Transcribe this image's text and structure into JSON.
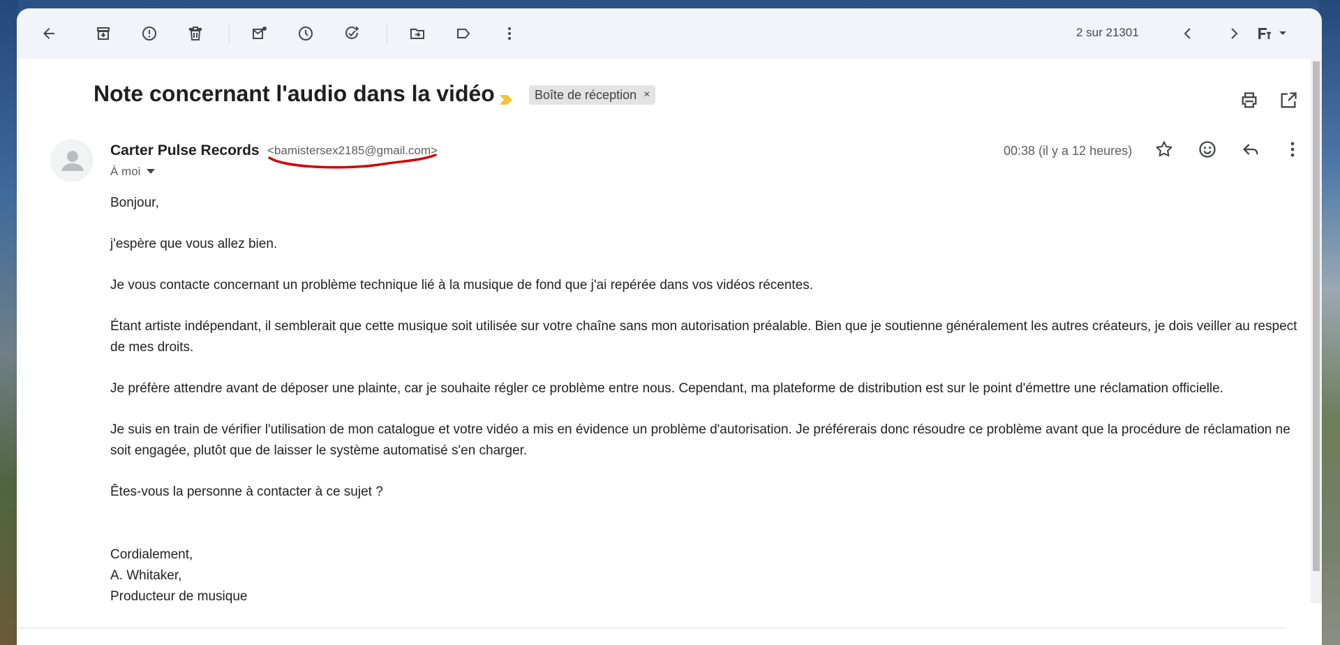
{
  "toolbar": {
    "pager_text": "2 sur 21301"
  },
  "email": {
    "subject": "Note concernant l'audio dans la vidéo",
    "label": "Boîte de réception",
    "label_close": "×",
    "sender_name": "Carter Pulse Records",
    "sender_email": "<bamistersex2185@gmail.com>",
    "to_line": "À moi",
    "timestamp": "00:38 (il y a 12 heures)",
    "body": [
      "Bonjour,",
      "j'espère que vous allez bien.",
      "Je vous contacte concernant un problème technique lié à la musique de fond que j'ai repérée dans vos vidéos récentes.",
      "Étant artiste indépendant, il semblerait que cette musique soit utilisée sur votre chaîne sans mon autorisation préalable. Bien que je soutienne généralement les autres créateurs, je dois veiller au respect de mes droits.",
      "Je préfère attendre avant de déposer une plainte, car je souhaite régler ce problème entre nous. Cependant, ma plateforme de distribution est sur le point d'émettre une réclamation officielle.",
      "Je suis en train de vérifier l'utilisation de mon catalogue et votre vidéo a mis en évidence un problème d'autorisation. Je préférerais donc résoudre ce problème avant que la procédure de réclamation ne soit engagée, plutôt que de laisser le système automatisé s'en charger.",
      "Êtes-vous la personne à contacter à ce sujet ?"
    ],
    "signature": [
      "Cordialement,",
      "A. Whitaker,",
      "Producteur de musique"
    ]
  },
  "colors": {
    "importance_marker": "#f4c430",
    "annotation_underline": "#d40000",
    "toolbar_bg": "#f1f4f9"
  },
  "icons": [
    "back-arrow-icon",
    "archive-icon",
    "report-spam-icon",
    "delete-icon",
    "mark-unread-icon",
    "snooze-icon",
    "add-task-icon",
    "move-to-icon",
    "label-icon",
    "more-vert-icon",
    "chevron-left-icon",
    "chevron-right-icon",
    "input-tools-icon",
    "print-icon",
    "open-new-window-icon",
    "star-icon",
    "emoji-icon",
    "reply-icon",
    "more-vert-icon"
  ]
}
